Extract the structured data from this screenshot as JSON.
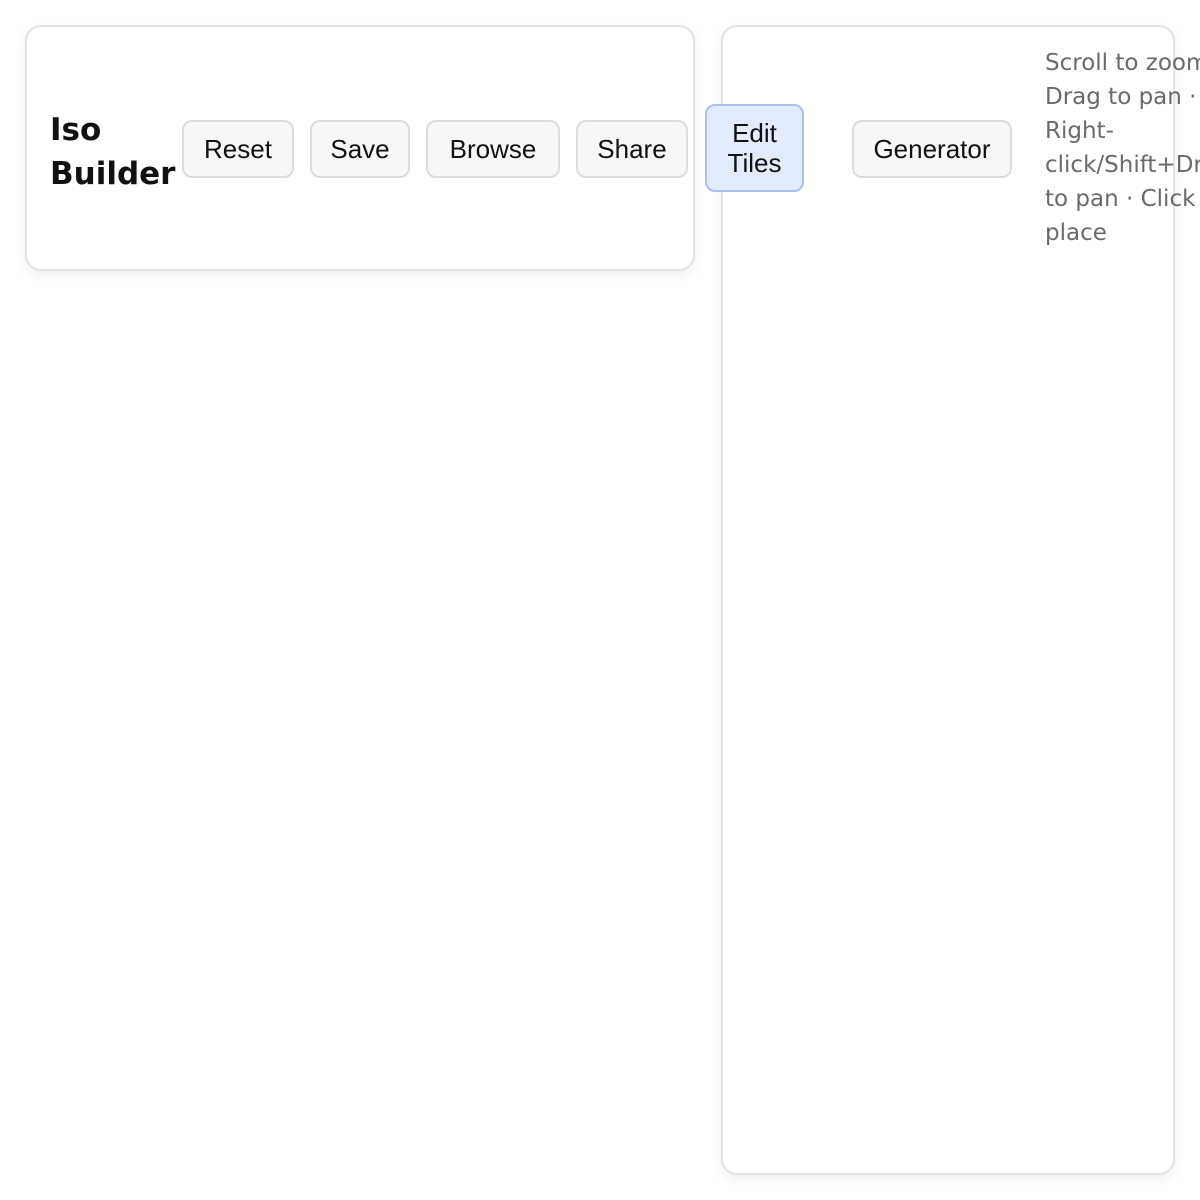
{
  "app": {
    "title": "Iso Builder"
  },
  "toolbar": {
    "reset_label": "Reset",
    "save_label": "Save",
    "browse_label": "Browse",
    "share_label": "Share",
    "edit_tiles_label_line1": "Edit",
    "edit_tiles_label_line2": "Tiles",
    "generator_label": "Generator"
  },
  "hint": {
    "line1": "Scroll to zoom",
    "line2": "Drag to pan ·",
    "line3": "Right-",
    "line4": "click/Shift+Drag",
    "line5": "to pan · Click to",
    "line6": "place"
  },
  "colors": {
    "accent_bg": "#e2ecfd",
    "accent_border": "#a9c1ef",
    "button_bg": "#f7f7f7",
    "hint_text": "#6a6a6a"
  }
}
